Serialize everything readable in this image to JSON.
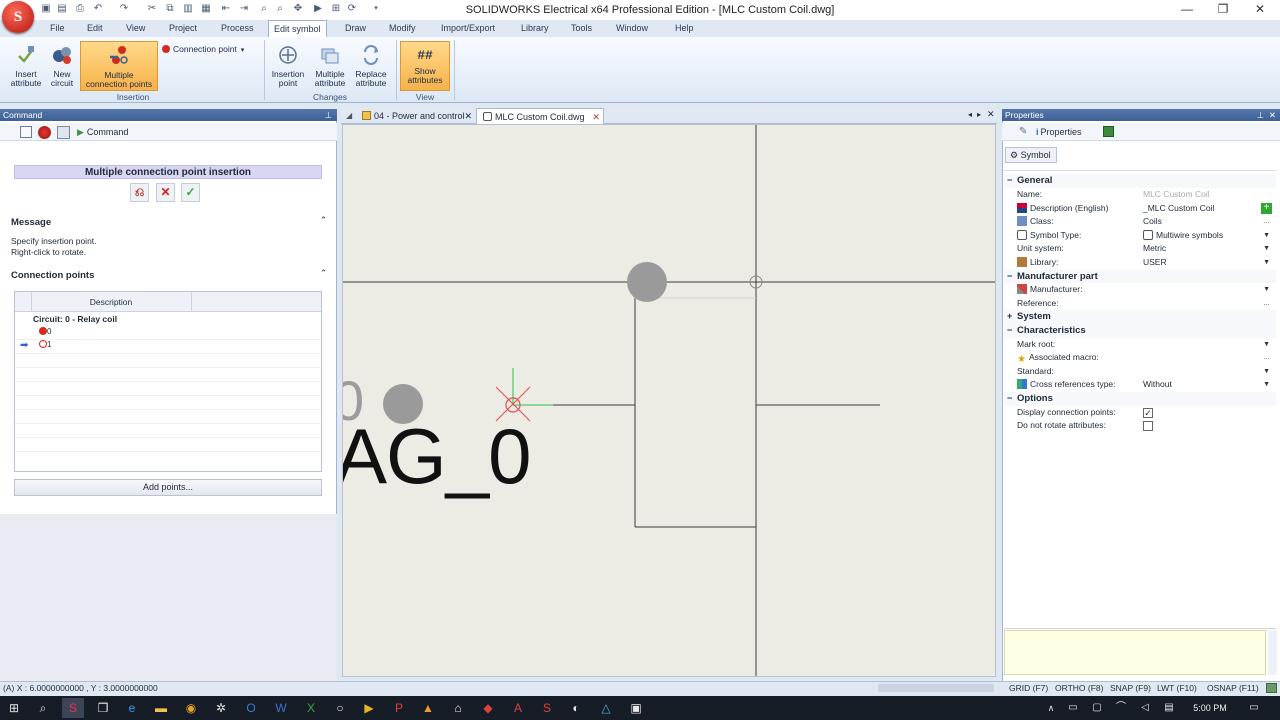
{
  "window": {
    "title": "SOLIDWORKS Electrical x64 Professional Edition - [MLC Custom Coil.dwg]",
    "logo": "S"
  },
  "menu": [
    "File",
    "Edit",
    "View",
    "Project",
    "Process",
    "Edit symbol",
    "Draw",
    "Modify",
    "Import/Export",
    "Library",
    "Tools",
    "Window",
    "Help"
  ],
  "ribbon": {
    "insert_attribute": "Insert\nattribute",
    "new_circuit": "New\ncircuit",
    "multiple_connection_points": "Multiple\nconnection points",
    "connection_point": "Connection point",
    "group_insertion": "Insertion",
    "insertion_point": "Insertion\npoint",
    "multiple_attribute": "Multiple\nattribute",
    "replace_attribute": "Replace\nattribute",
    "group_changes": "Changes",
    "show_attributes": "Show\nattributes",
    "show_attributes_icon": "##",
    "group_view": "View"
  },
  "command_panel": {
    "title": "Command",
    "tab_label": "Command",
    "header": "Multiple connection point insertion",
    "message_title": "Message",
    "message_line1": "Specify insertion point.",
    "message_line2": "Right-click to rotate.",
    "cp_title": "Connection points",
    "grid_col_description": "Description",
    "circuit_label": "Circuit: 0 - Relay coil",
    "point_0": "0",
    "point_1": "1",
    "add_points": "Add points..."
  },
  "document_tabs": [
    {
      "label": "04 - Power and control",
      "active": false
    },
    {
      "label": "MLC Custom Coil.dwg",
      "active": true
    }
  ],
  "canvas": {
    "big_text": "AG_0",
    "small_text": "0"
  },
  "properties": {
    "title": "Properties",
    "tab_label": "Properties",
    "symbol_tab": "Symbol",
    "general": "General",
    "name_label": "Name:",
    "name_value": "MLC Custom Coil",
    "description_label": "Description (English)",
    "description_value": "_MLC Custom Coil",
    "class_label": "Class:",
    "class_value": "Coils",
    "symbol_type_label": "Symbol Type:",
    "symbol_type_value": "Multiwire symbols",
    "unit_label": "Unit system:",
    "unit_value": "Metric",
    "library_label": "Library:",
    "library_value": "USER",
    "manufacturer_part": "Manufacturer part",
    "manufacturer_label": "Manufacturer:",
    "reference_label": "Reference:",
    "system": "System",
    "characteristics": "Characteristics",
    "mark_root_label": "Mark root:",
    "macro_label": "Associated macro:",
    "standard_label": "Standard:",
    "xref_label": "Cross references type:",
    "xref_value": "Without",
    "options": "Options",
    "display_cp_label": "Display connection points:",
    "display_cp_checked": true,
    "no_rotate_label": "Do not rotate attributes:",
    "no_rotate_checked": false
  },
  "status": {
    "coords": "(A) X : 6.0000000000 , Y : 3.0000000000",
    "grid": "GRID (F7)",
    "ortho": "ORTHO (F8)",
    "snap": "SNAP (F9)",
    "lwt": "LWT (F10)",
    "osnap": "OSNAP (F11)"
  },
  "taskbar": {
    "clock": "5:00 PM"
  },
  "colors": {
    "accent_orange": "#f7b24a",
    "panel_header": "#3d5f93",
    "canvas_bg": "#ecebe4"
  }
}
